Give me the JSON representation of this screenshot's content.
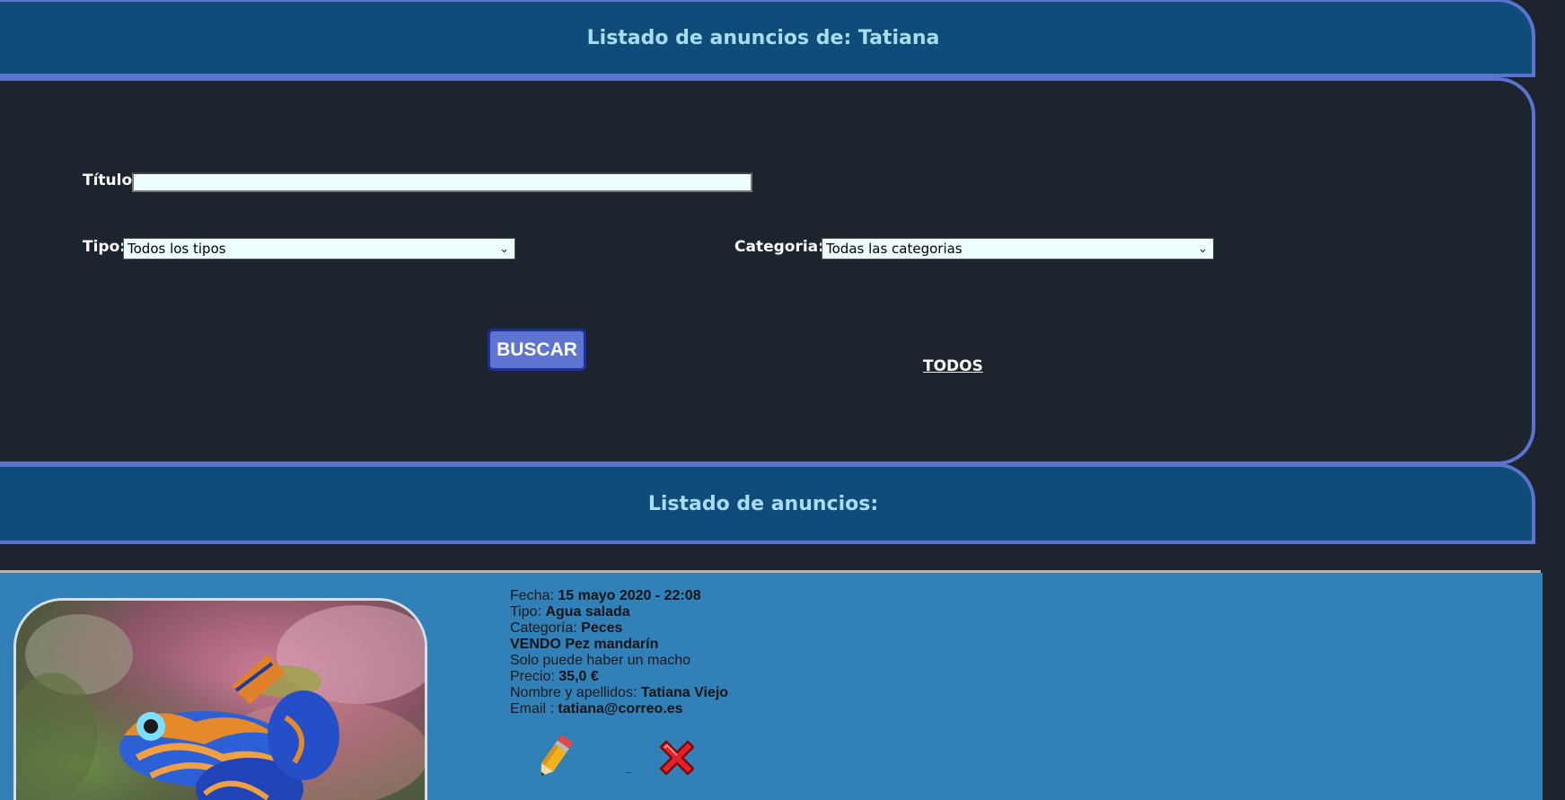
{
  "header": {
    "title": "Listado de anuncios de: Tatiana"
  },
  "search_form": {
    "titulo_label": "Título:",
    "titulo_value": "",
    "tipo_label": "Tipo:",
    "tipo_selected": "Todos los tipos",
    "categoria_label": "Categoria:",
    "categoria_selected": "Todas las categorias",
    "buscar_button": "BUSCAR",
    "todos_link": "TODOS"
  },
  "results_header": {
    "title": "Listado de anuncios:"
  },
  "listing": {
    "photo_icon": "mandarin-fish-photo",
    "fecha_label": "Fecha:",
    "fecha_value": "15 mayo 2020 - 22:08",
    "tipo_label": "Tipo:",
    "tipo_value": "Agua salada",
    "categoria_label": "Categoría:",
    "categoria_value": "Peces",
    "title": "VENDO Pez mandarín",
    "description": "Solo puede haber un macho",
    "precio_label": "Precio:",
    "precio_value": "35,0 €",
    "nombre_label": "Nombre y apellidos:",
    "nombre_value": "Tatiana Viejo",
    "email_label": "Email :",
    "email_value": "tatiana@correo.es",
    "edit_icon": "pencil-icon",
    "delete_icon": "red-x-icon"
  },
  "colors": {
    "background": "#1c252d",
    "band": "#0f4c7a",
    "border_accent": "#5b73cf",
    "band_text": "#a7dcf3",
    "listing_bg": "#3180b8",
    "button_bg": "#5d75d0",
    "input_bg": "#eefeff"
  }
}
